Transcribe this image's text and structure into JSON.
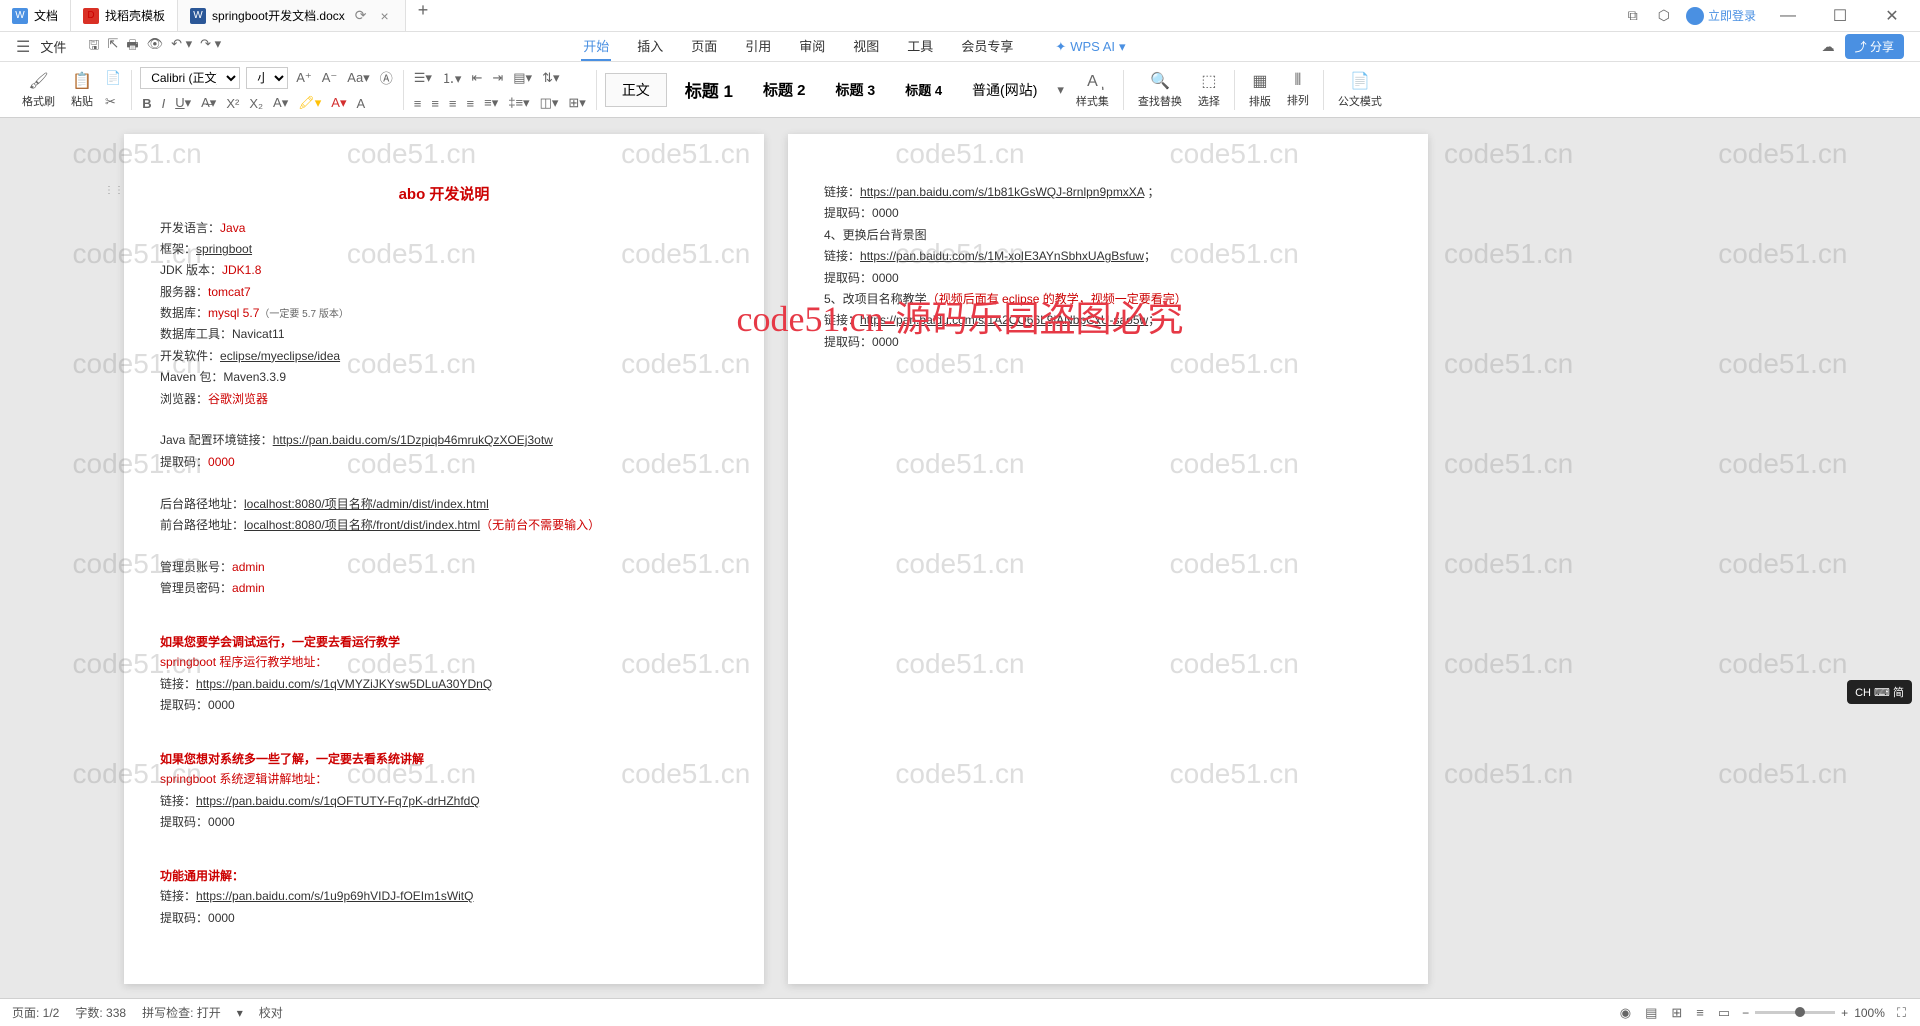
{
  "tabs": [
    {
      "icon": "W",
      "label": "文档"
    },
    {
      "icon": "D",
      "label": "找稻壳模板"
    },
    {
      "icon": "W",
      "label": "springboot开发文档.docx"
    }
  ],
  "login": "立即登录",
  "menu": {
    "file": "文件",
    "items": [
      "开始",
      "插入",
      "页面",
      "引用",
      "审阅",
      "视图",
      "工具",
      "会员专享"
    ],
    "wps_ai": "WPS AI",
    "share": "分享"
  },
  "ribbon": {
    "format_painter": "格式刷",
    "paste": "粘贴",
    "font_name": "Calibri (正文)",
    "font_size": "小四",
    "styles": {
      "normal": "正文",
      "h1": "标题 1",
      "h2": "标题 2",
      "h3": "标题 3",
      "h4": "标题 4",
      "web": "普通(网站)"
    },
    "style_set": "样式集",
    "find_replace": "查找替换",
    "select": "选择",
    "sort": "排版",
    "arrange": "排列",
    "official": "公文模式"
  },
  "doc": {
    "title": "abo 开发说明",
    "lines1": [
      {
        "label": "开发语言：",
        "value": "Java"
      },
      {
        "label": "框架：",
        "value": "springboot",
        "link": true
      },
      {
        "label": "JDK 版本：",
        "value": "JDK1.8"
      },
      {
        "label": "服务器：",
        "value": "tomcat7"
      },
      {
        "label": "数据库：",
        "value": "mysql 5.7",
        "note": "（一定要 5.7 版本）"
      },
      {
        "label": "数据库工具：",
        "value": "Navicat11",
        "plain": true
      },
      {
        "label": "开发软件：",
        "value": "eclipse/myeclipse/idea",
        "link": true
      },
      {
        "label": "Maven 包：",
        "value": "Maven3.3.9",
        "plain": true
      },
      {
        "label": "浏览器：",
        "value": "谷歌浏览器"
      }
    ],
    "java_env": {
      "label": "Java 配置环境链接：",
      "url": "https://pan.baidu.com/s/1Dzpiqb46mrukQzXOEj3otw"
    },
    "code_label": "提取码：",
    "code": "0000",
    "backend": {
      "label": "后台路径地址：",
      "value": "localhost:8080/项目名称/admin/dist/index.html"
    },
    "frontend": {
      "label": "前台路径地址：",
      "value": "localhost:8080/项目名称/front/dist/index.html",
      "note": "（无前台不需要输入）"
    },
    "admin_user": {
      "label": "管理员账号：",
      "value": "admin"
    },
    "admin_pass": {
      "label": "管理员密码：",
      "value": "admin"
    },
    "section1": {
      "title": "如果您要学会调试运行，一定要去看运行教学",
      "sub": "springboot 程序运行教学地址：",
      "link_label": "链接：",
      "url": "https://pan.baidu.com/s/1qVMYZiJKYsw5DLuA30YDnQ"
    },
    "section2": {
      "title": "如果您想对系统多一些了解，一定要去看系统讲解",
      "sub": "springboot 系统逻辑讲解地址：",
      "link_label": "链接：",
      "url": "https://pan.baidu.com/s/1qOFTUTY-Fq7pK-drHZhfdQ"
    },
    "section3": {
      "title": "功能通用讲解：",
      "link_label": "链接：",
      "url": "https://pan.baidu.com/s/1u9p69hVIDJ-fOEIm1sWitQ"
    },
    "page2": {
      "l1": {
        "label": "链接：",
        "url": "https://pan.baidu.com/s/1b81kGsWQJ-8rnlpn9pmxXA",
        "suffix": " ；"
      },
      "l2": "4、更换后台背景图",
      "l3": {
        "label": "链接：",
        "url": "https://pan.baidu.com/s/1M-xoIE3AYnSbhxUAgBsfuw",
        "suffix": "；"
      },
      "l4": {
        "prefix": "5、改项目名称教学",
        "note": "（视频后面有 eclipse 的教学，视频一定要看完）"
      },
      "l5": {
        "label": "链接：",
        "url": "https://pan.baidu.com/s/1A2CO66L9jANbpCxU-sao5w",
        "suffix": "；"
      }
    }
  },
  "watermark": "code51.cn",
  "center_watermark": "code51.cn-源码乐园盗图必究",
  "status": {
    "page": "页面: 1/2",
    "words": "字数: 338",
    "spell": "拼写检查: 打开",
    "proof": "校对",
    "zoom": "100%"
  },
  "ime": "CH ⌨ 简"
}
